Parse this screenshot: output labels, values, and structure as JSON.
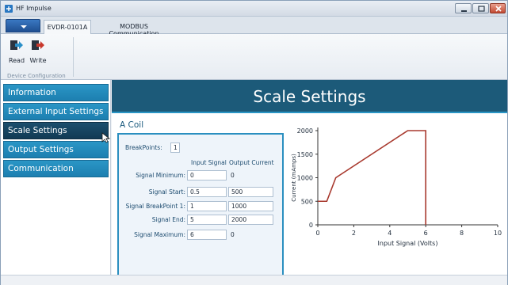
{
  "window": {
    "title": "HF Impulse"
  },
  "tabs": [
    {
      "label": "EVDR-0101A",
      "active": true
    },
    {
      "label": "MODBUS Communication",
      "active": false
    }
  ],
  "ribbon": {
    "read_label": "Read",
    "write_label": "Write",
    "group_label": "Device Configuration",
    "read_icon": "read-arrow-icon",
    "write_icon": "write-arrow-icon"
  },
  "sidebar": {
    "items": [
      {
        "label": "Information",
        "selected": false
      },
      {
        "label": "External Input Settings",
        "selected": false
      },
      {
        "label": "Scale Settings",
        "selected": true
      },
      {
        "label": "Output Settings",
        "selected": false
      },
      {
        "label": "Communication",
        "selected": false
      }
    ]
  },
  "main": {
    "header": "Scale Settings",
    "panel_title": "A Coil",
    "breakpoints_label": "BreakPoints:",
    "breakpoints_value": "1",
    "col_input": "Input Signal",
    "col_output": "Output Current",
    "rows": [
      {
        "label": "Signal Minimum:",
        "input": "0",
        "output": "0",
        "output_editable": false
      },
      {
        "label": "Signal Start:",
        "input": "0.5",
        "output": "500",
        "output_editable": true
      },
      {
        "label": "Signal BreakPoint 1:",
        "input": "1",
        "output": "1000",
        "output_editable": true
      },
      {
        "label": "Signal End:",
        "input": "5",
        "output": "2000",
        "output_editable": true
      },
      {
        "label": "Signal Maximum:",
        "input": "6",
        "output": "0",
        "output_editable": false
      }
    ]
  },
  "colors": {
    "nav": "#2a96c6",
    "nav_selected": "#133f5b",
    "header": "#1c5a79",
    "line": "#a8392e"
  },
  "chart_data": {
    "type": "line",
    "xlabel": "Input Signal (Volts)",
    "ylabel": "Current (mAmps)",
    "xlim": [
      0,
      10
    ],
    "ylim": [
      0,
      2000
    ],
    "x_ticks": [
      0,
      2,
      4,
      6,
      8,
      10
    ],
    "y_ticks": [
      0,
      500,
      1000,
      1500,
      2000
    ],
    "grid": false,
    "series": [
      {
        "color": "#a8392e",
        "x": [
          0,
          0.5,
          1,
          5,
          6,
          6
        ],
        "y": [
          500,
          500,
          1000,
          2000,
          2000,
          0
        ]
      }
    ]
  }
}
